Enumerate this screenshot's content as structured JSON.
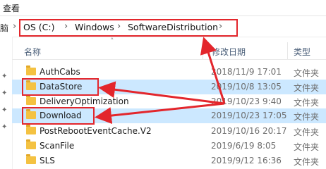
{
  "menu": {
    "view_label": "查看"
  },
  "address": {
    "cut_text": "脑",
    "crumbs": [
      "OS (C:)",
      "Windows",
      "SoftwareDistribution"
    ]
  },
  "columns": {
    "name": "名称",
    "date": "修改日期",
    "type": "类型"
  },
  "files": [
    {
      "name": "AuthCabs",
      "date": "2018/11/9 17:01",
      "type": "文件夹",
      "selected": false
    },
    {
      "name": "DataStore",
      "date": "2019/10/8 13:05",
      "type": "文件夹",
      "selected": true
    },
    {
      "name": "DeliveryOptimization",
      "date": "2019/10/23 9:40",
      "type": "文件夹",
      "selected": false
    },
    {
      "name": "Download",
      "date": "2019/10/23 17:05",
      "type": "文件夹",
      "selected": true
    },
    {
      "name": "PostRebootEventCache.V2",
      "date": "2019/10/16 20:17",
      "type": "文件夹",
      "selected": false
    },
    {
      "name": "ScanFile",
      "date": "2019/6/19 8:05",
      "type": "文件夹",
      "selected": false
    },
    {
      "name": "SLS",
      "date": "2019/9/12 16:36",
      "type": "文件夹",
      "selected": false
    }
  ],
  "colors": {
    "highlight": "#e3262c",
    "selection": "#cce8ff",
    "folder": "#f4c242"
  }
}
